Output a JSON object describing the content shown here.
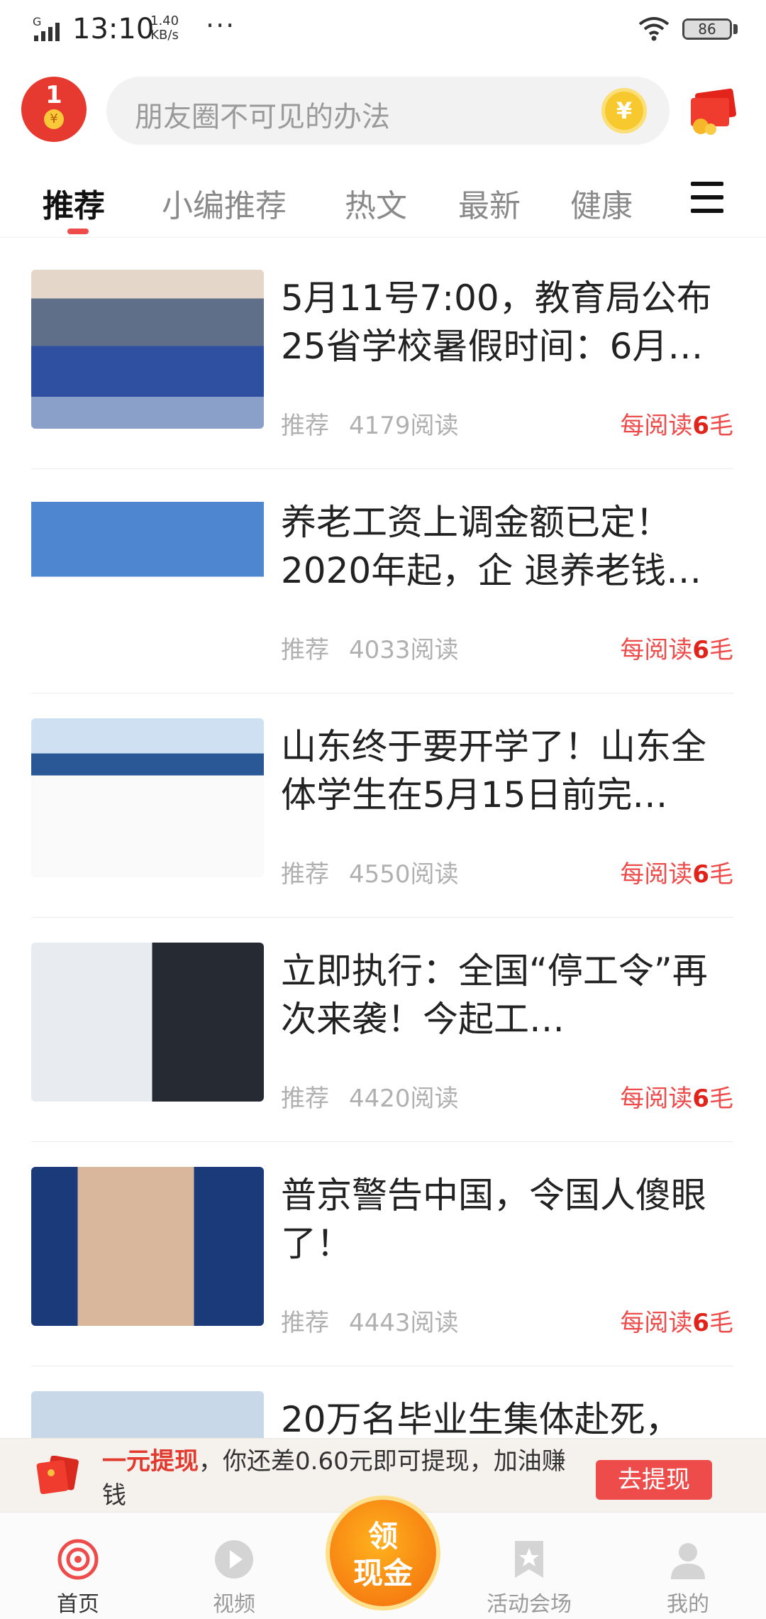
{
  "status_bar": {
    "network": "G",
    "time": "13:10",
    "speed_value": "1.40",
    "speed_unit": "KB/s",
    "more": "···",
    "battery": "86"
  },
  "header": {
    "redpacket_count": "1",
    "redpacket_coin": "¥",
    "search_placeholder": "朋友圈不可见的办法",
    "search_coin": "¥"
  },
  "tabs": [
    {
      "label": "推荐",
      "active": true
    },
    {
      "label": "小编推荐"
    },
    {
      "label": "热文"
    },
    {
      "label": "最新"
    },
    {
      "label": "健康"
    }
  ],
  "articles": [
    {
      "title": "5月11号7:00，教育局公布25省学校暑假时间：6月…",
      "tag": "推荐",
      "reads": "4179阅读",
      "reward_prefix": "每阅读",
      "reward_num": "6",
      "reward_suffix": "毛"
    },
    {
      "title": "养老工资上调金额已定！2020年起，企 退养老钱…",
      "tag": "推荐",
      "reads": "4033阅读",
      "reward_prefix": "每阅读",
      "reward_num": "6",
      "reward_suffix": "毛"
    },
    {
      "title": "山东终于要开学了！山东全体学生在5月15日前完…",
      "tag": "推荐",
      "reads": "4550阅读",
      "reward_prefix": "每阅读",
      "reward_num": "6",
      "reward_suffix": "毛"
    },
    {
      "title": "立即执行：全国“停工令”再次来袭！今起工…",
      "tag": "推荐",
      "reads": "4420阅读",
      "reward_prefix": "每阅读",
      "reward_num": "6",
      "reward_suffix": "毛"
    },
    {
      "title": "普京警告中国，令国人傻眼了！",
      "tag": "推荐",
      "reads": "4443阅读",
      "reward_prefix": "每阅读",
      "reward_num": "6",
      "reward_suffix": "毛"
    },
    {
      "title": "20万名毕业生集体赴死，",
      "tag": "",
      "reads": "",
      "reward_prefix": "",
      "reward_num": "",
      "reward_suffix": ""
    }
  ],
  "banner": {
    "highlight": "一元提现",
    "text": "，你还差0.60元即可提现，加油赚钱",
    "button": "去提现"
  },
  "nav": {
    "home": "首页",
    "video": "视频",
    "center_top": "领",
    "center_bottom": "现金",
    "activity": "活动会场",
    "mine": "我的"
  },
  "colors": {
    "accent": "#ee4b4b",
    "coin": "#f7c92f",
    "center_button": "#f36a0c"
  }
}
